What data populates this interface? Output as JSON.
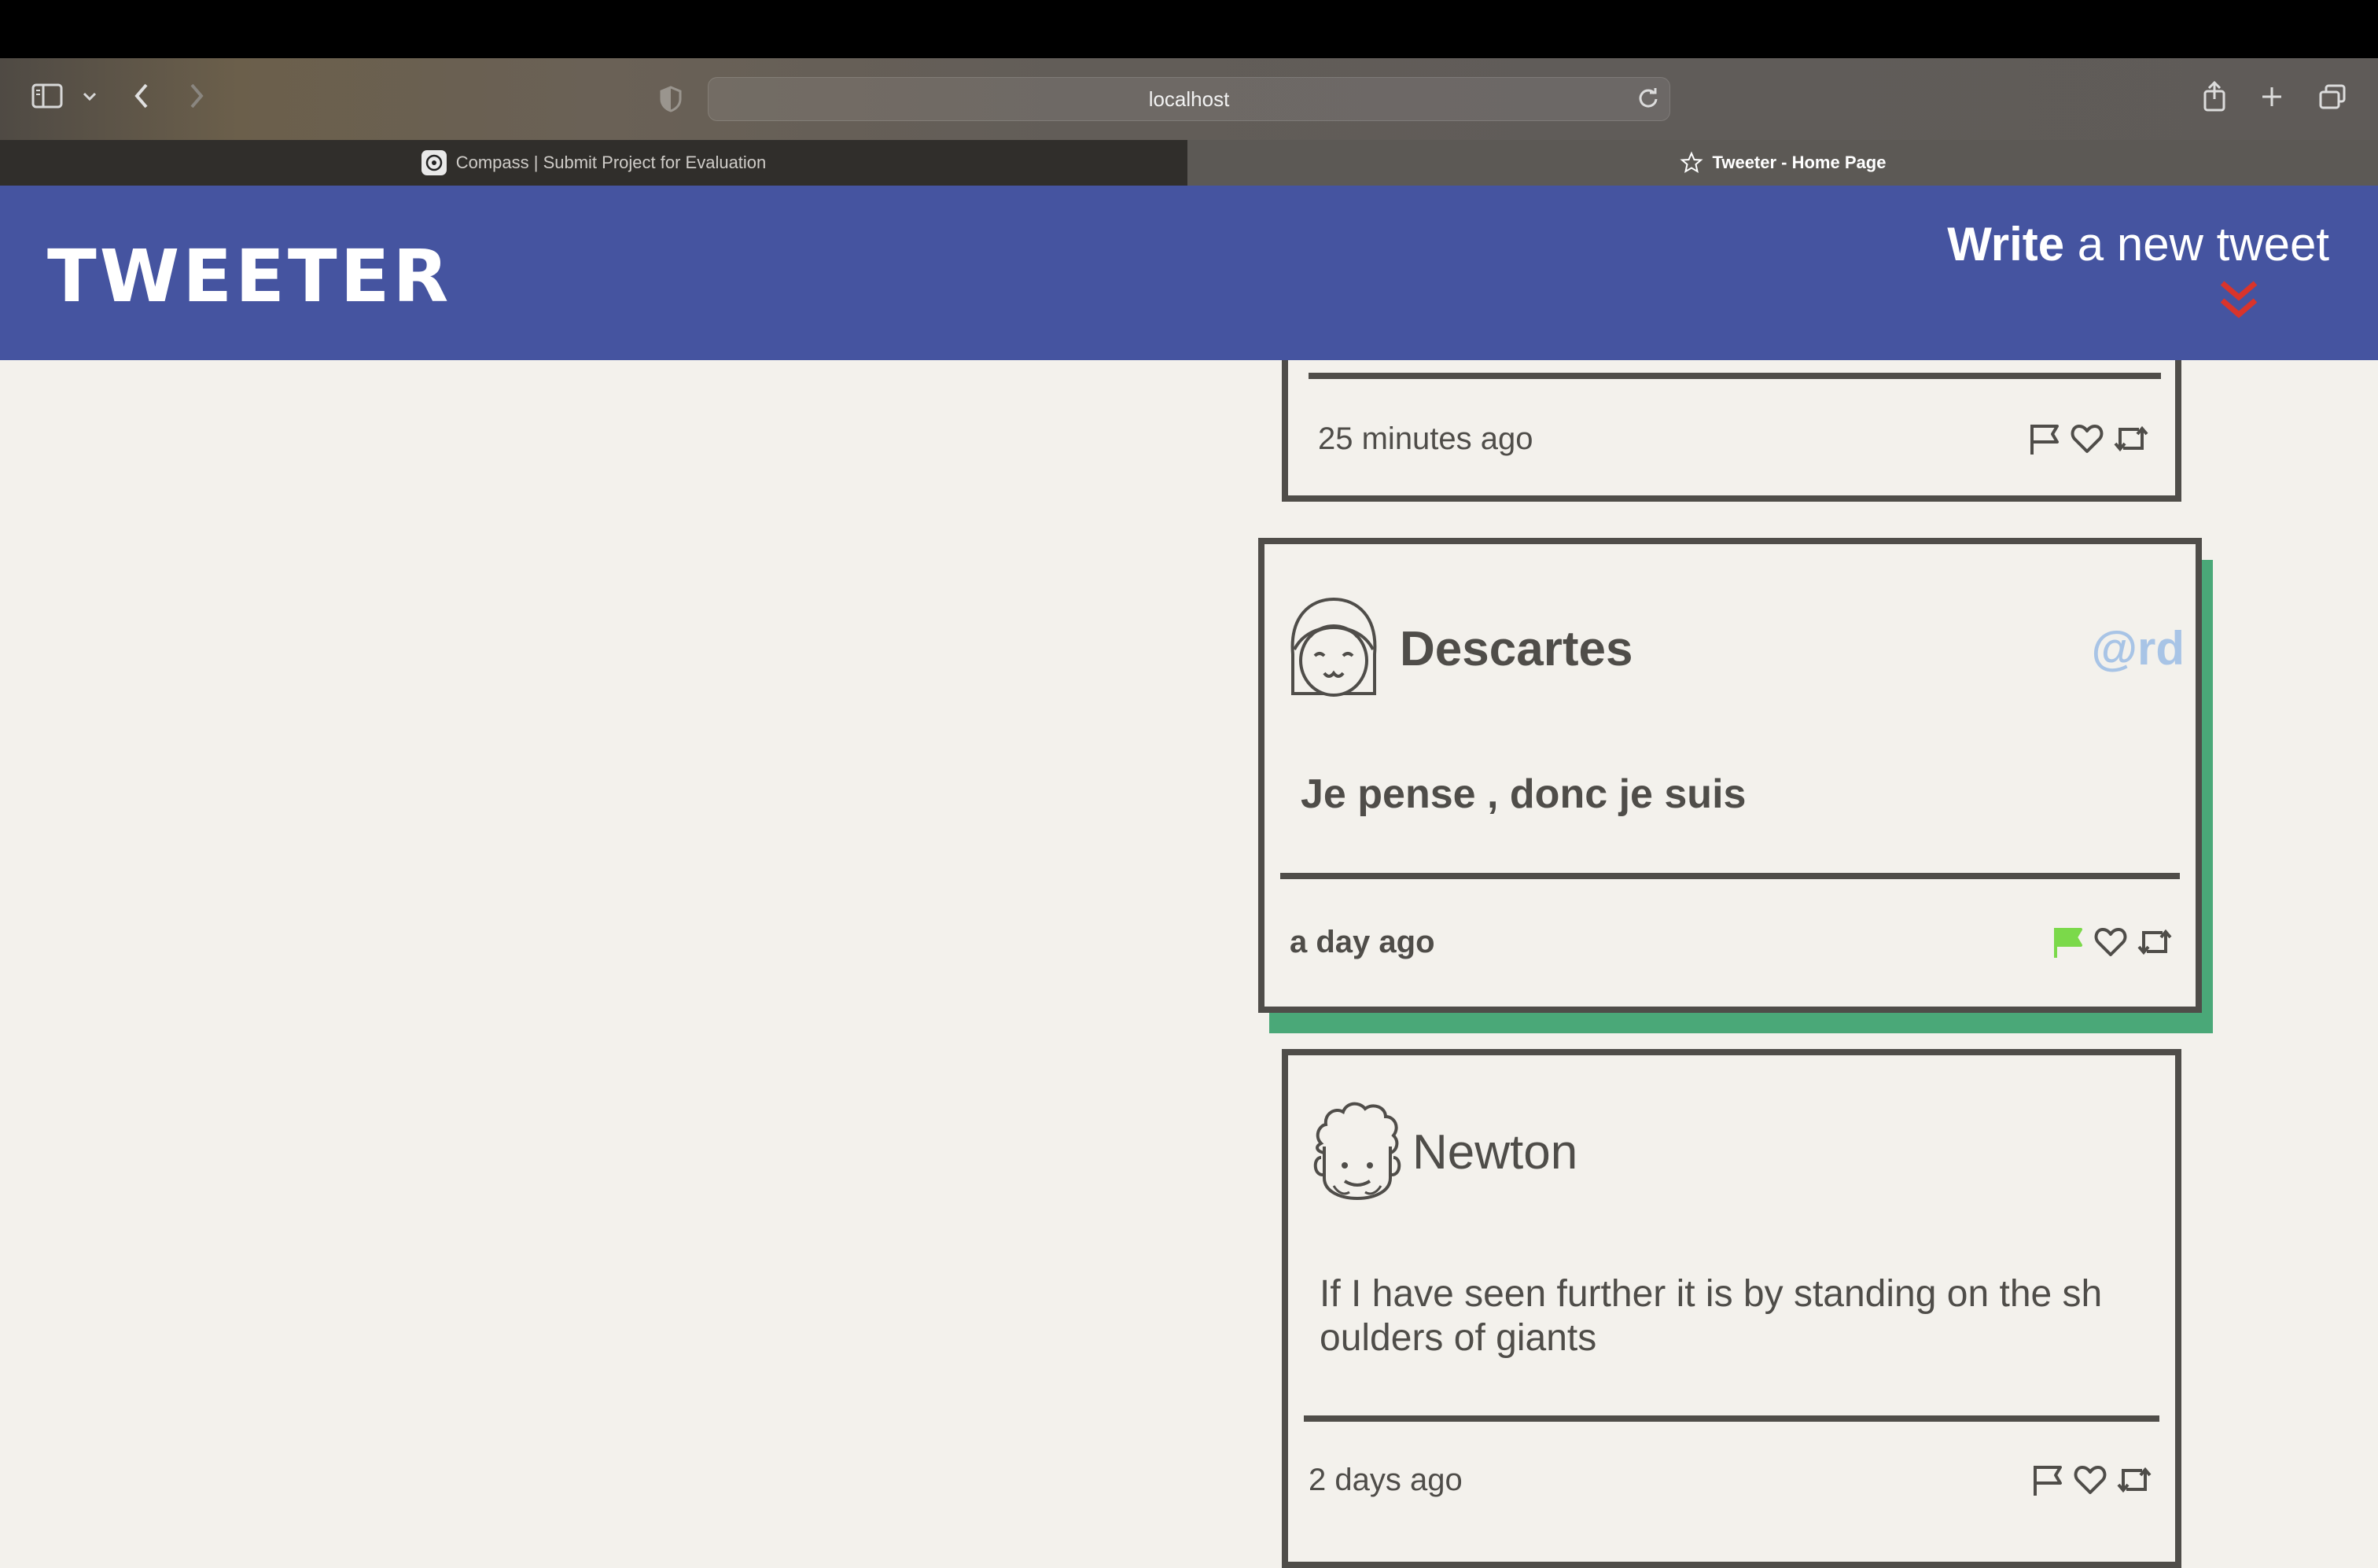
{
  "browser": {
    "url": "localhost",
    "tabs": [
      {
        "label": "Compass | Submit Project for Evaluation",
        "active": false
      },
      {
        "label": "Tweeter - Home Page",
        "active": true
      }
    ]
  },
  "header": {
    "brand": "TWEETER",
    "compose_bold": "Write",
    "compose_rest": " a new tweet",
    "compose_arrow_color": "#d9342b"
  },
  "tweets": [
    {
      "time": "25 minutes ago",
      "flagged": false
    },
    {
      "user": "Descartes",
      "handle": "@rd",
      "text": "Je pense , donc je suis",
      "time": "a day ago",
      "flagged": true,
      "hovered": true,
      "flag_color": "#7bd94a",
      "shadow_color": "#4aa878"
    },
    {
      "user": "Newton",
      "text": "If I have seen further it is by standing on the sh oulders of giants",
      "time": "2 days ago",
      "flagged": false
    }
  ]
}
